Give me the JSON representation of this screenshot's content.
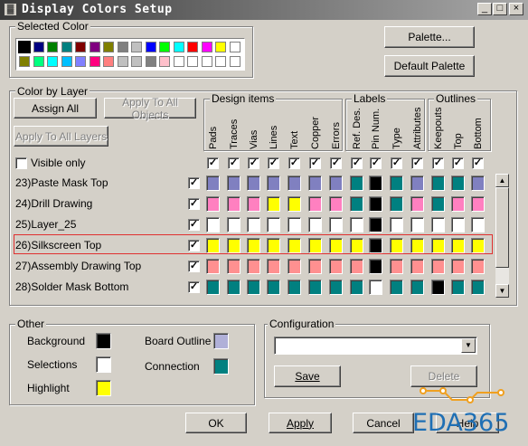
{
  "window": {
    "title": "Display Colors Setup",
    "min": "_",
    "max": "□",
    "close": "×"
  },
  "selected_color": {
    "label": "Selected Color",
    "row1": [
      "#000000",
      "#000080",
      "#008000",
      "#008080",
      "#800000",
      "#800080",
      "#808000",
      "#808080",
      "#c0c0c0",
      "#0000ff",
      "#00ff00",
      "#00ffff",
      "#ff0000",
      "#ff00ff",
      "#ffff00",
      "#ffffff"
    ],
    "row2": [
      "#808000",
      "#00ff7f",
      "#00ffff",
      "#00bfff",
      "#8080ff",
      "#ff0080",
      "#ff8080",
      "#c0c0c0",
      "#c0c0c0",
      "#808080",
      "#ffc0cb",
      "#ffffff",
      "#ffffff",
      "#ffffff",
      "#ffffff",
      "#ffffff"
    ]
  },
  "buttons": {
    "palette": "Palette...",
    "default_palette": "Default Palette",
    "assign_all": "Assign All",
    "apply_all_objects": "Apply To All Objects",
    "apply_all_layers": "Apply To All Layers",
    "save": "Save",
    "delete": "Delete",
    "ok": "OK",
    "apply": "Apply",
    "cancel": "Cancel",
    "help": "Help"
  },
  "color_by_layer": {
    "label": "Color by Layer",
    "groups": {
      "design": "Design items",
      "labels": "Labels",
      "outlines": "Outlines"
    },
    "columns": [
      "Pads",
      "Traces",
      "Vias",
      "Lines",
      "Text",
      "Copper",
      "Errors",
      "Ref. Des.",
      "Pin Num.",
      "Type",
      "Attributes",
      "Keepouts",
      "Top",
      "Bottom"
    ],
    "visible_only": "Visible only",
    "layers": [
      {
        "name": "23)Paste Mask Top",
        "colors": [
          "#8080c0",
          "#8080c0",
          "#8080c0",
          "#8080c0",
          "#8080c0",
          "#8080c0",
          "#8080c0",
          "#008080",
          "#000000",
          "#008080",
          "#8080c0",
          "#008080",
          "#008080",
          "#8080c0"
        ]
      },
      {
        "name": "24)Drill Drawing",
        "colors": [
          "#ff80c0",
          "#ff80c0",
          "#ff80c0",
          "#ffff00",
          "#ffff00",
          "#ff80c0",
          "#ff80c0",
          "#008080",
          "#000000",
          "#008080",
          "#ff80c0",
          "#008080",
          "#ff80c0",
          "#ff80c0"
        ]
      },
      {
        "name": "25)Layer_25",
        "colors": [
          "#ffffff",
          "#ffffff",
          "#ffffff",
          "#ffffff",
          "#ffffff",
          "#ffffff",
          "#ffffff",
          "#ffffff",
          "#000000",
          "#ffffff",
          "#ffffff",
          "#ffffff",
          "#ffffff",
          "#ffffff"
        ]
      },
      {
        "name": "26)Silkscreen Top",
        "colors": [
          "#ffff00",
          "#ffff00",
          "#ffff00",
          "#ffff00",
          "#ffff00",
          "#ffff00",
          "#ffff00",
          "#ffff00",
          "#000000",
          "#ffff00",
          "#ffff00",
          "#ffff00",
          "#ffff00",
          "#ffff00"
        ]
      },
      {
        "name": "27)Assembly Drawing Top",
        "colors": [
          "#ff9090",
          "#ff9090",
          "#ff9090",
          "#ff9090",
          "#ff9090",
          "#ff9090",
          "#ff9090",
          "#ff9090",
          "#000000",
          "#ff9090",
          "#ff9090",
          "#ff9090",
          "#ff9090",
          "#ff9090"
        ]
      },
      {
        "name": "28)Solder Mask Bottom",
        "colors": [
          "#008080",
          "#008080",
          "#008080",
          "#008080",
          "#008080",
          "#008080",
          "#008080",
          "#008080",
          "#ffffff",
          "#008080",
          "#008080",
          "#000000",
          "#008080",
          "#008080"
        ]
      }
    ]
  },
  "other": {
    "label": "Other",
    "background": {
      "label": "Background",
      "color": "#000000"
    },
    "selections": {
      "label": "Selections",
      "color": "#ffffff"
    },
    "highlight": {
      "label": "Highlight",
      "color": "#ffff00"
    },
    "board_outline": {
      "label": "Board Outline",
      "color": "#b0b0d8"
    },
    "connection": {
      "label": "Connection",
      "color": "#008080"
    }
  },
  "configuration": {
    "label": "Configuration",
    "value": ""
  },
  "watermark": "EDA365"
}
